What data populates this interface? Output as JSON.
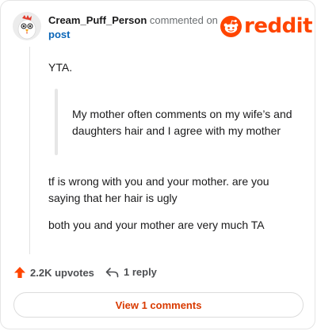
{
  "header": {
    "author": "Cream_Puff_Person",
    "action": "commented on",
    "post_link": "post",
    "logo_word": "reddit"
  },
  "comment": {
    "opening": "YTA.",
    "quote": "My mother often comments on my wife’s and daughters hair and I agree with my mother",
    "paragraph_1": "tf is wrong with you and your mother. are you saying that her hair is ugly",
    "paragraph_2": "both you and your mother are very much TA"
  },
  "actions": {
    "upvotes": "2.2K upvotes",
    "reply": "1 reply",
    "view_comments": "View 1 comments"
  },
  "colors": {
    "brand": "#ff4500",
    "link": "#0a66b8",
    "view_button_text": "#d93a00"
  }
}
